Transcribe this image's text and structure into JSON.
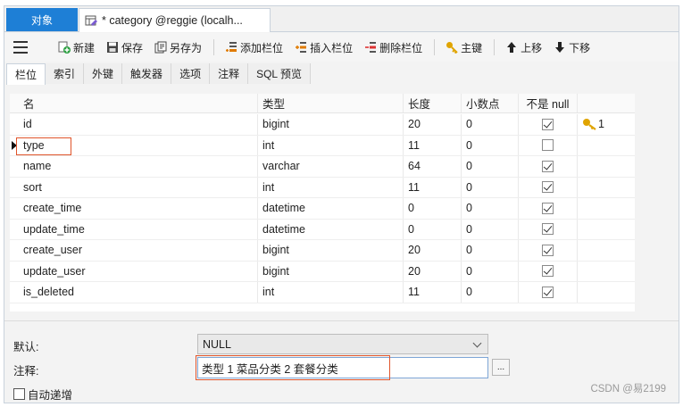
{
  "tabs": {
    "objects": "对象",
    "document": "* category @reggie (localh..."
  },
  "toolbar": {
    "new": "新建",
    "save": "保存",
    "save_as": "另存为",
    "add_field": "添加栏位",
    "insert_field": "插入栏位",
    "delete_field": "删除栏位",
    "primary_key": "主键",
    "move_up": "上移",
    "move_down": "下移"
  },
  "subtabs": [
    "栏位",
    "索引",
    "外键",
    "触发器",
    "选项",
    "注释",
    "SQL 预览"
  ],
  "table": {
    "headers": [
      "名",
      "类型",
      "长度",
      "小数点",
      "不是 null",
      ""
    ],
    "rows": [
      {
        "name": "id",
        "type": "bigint",
        "length": "20",
        "decimals": "0",
        "not_null": true,
        "key": "1"
      },
      {
        "name": "type",
        "type": "int",
        "length": "11",
        "decimals": "0",
        "not_null": false,
        "key": ""
      },
      {
        "name": "name",
        "type": "varchar",
        "length": "64",
        "decimals": "0",
        "not_null": true,
        "key": ""
      },
      {
        "name": "sort",
        "type": "int",
        "length": "11",
        "decimals": "0",
        "not_null": true,
        "key": ""
      },
      {
        "name": "create_time",
        "type": "datetime",
        "length": "0",
        "decimals": "0",
        "not_null": true,
        "key": ""
      },
      {
        "name": "update_time",
        "type": "datetime",
        "length": "0",
        "decimals": "0",
        "not_null": true,
        "key": ""
      },
      {
        "name": "create_user",
        "type": "bigint",
        "length": "20",
        "decimals": "0",
        "not_null": true,
        "key": ""
      },
      {
        "name": "update_user",
        "type": "bigint",
        "length": "20",
        "decimals": "0",
        "not_null": true,
        "key": ""
      },
      {
        "name": "is_deleted",
        "type": "int",
        "length": "11",
        "decimals": "0",
        "not_null": true,
        "key": ""
      }
    ]
  },
  "props": {
    "default_label": "默认:",
    "default_value": "NULL",
    "comment_label": "注释:",
    "comment_value": "类型   1 菜品分类 2 套餐分类",
    "more_label": "...",
    "auto_increment_label": "自动递增"
  },
  "watermark": "CSDN @易2199",
  "colors": {
    "accent": "#1e7fd6",
    "highlight": "#e0552b",
    "key": "#e0a400"
  }
}
